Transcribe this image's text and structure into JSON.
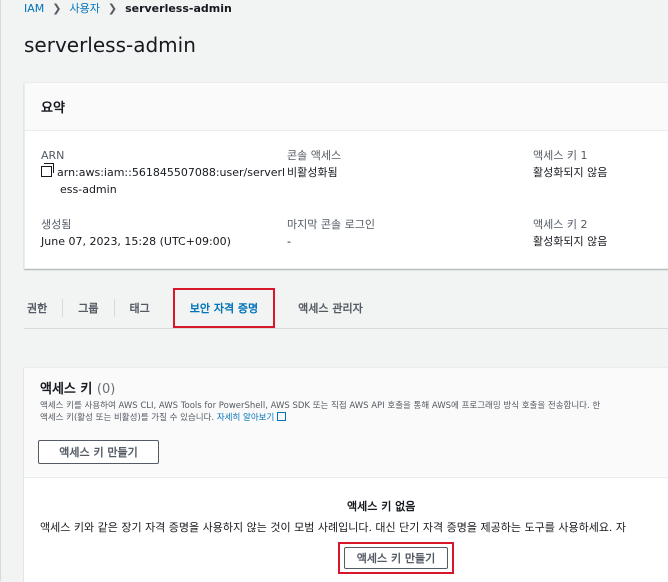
{
  "breadcrumb": {
    "root": "IAM",
    "level1": "사용자",
    "current": "serverless-admin",
    "separator": "❯"
  },
  "page_title": "serverless-admin",
  "summary": {
    "title": "요약",
    "arn_label": "ARN",
    "arn_line1": "arn:aws:iam::561845507088:user/serverl",
    "arn_line2": "ess-admin",
    "created_label": "생성됨",
    "created_value": "June 07, 2023, 15:28 (UTC+09:00)",
    "console_access_label": "콘솔 액세스",
    "console_access_value": "비활성화됨",
    "last_login_label": "마지막 콘솔 로그인",
    "last_login_value": "-",
    "access_key1_label": "액세스 키 1",
    "access_key1_value": "활성화되지 않음",
    "access_key2_label": "액세스 키 2",
    "access_key2_value": "활성화되지 않음"
  },
  "tabs": [
    "권한",
    "그룹",
    "태그",
    "보안 자격 증명",
    "액세스 관리자"
  ],
  "active_tab": "보안 자격 증명",
  "access_keys": {
    "title": "액세스 키",
    "count": "(0)",
    "desc_line1": "액세스 키를 사용하여 AWS CLI, AWS Tools for PowerShell, AWS SDK 또는 직접 AWS API 호출을 통해 AWS에 프로그래밍 방식 호출을 전송합니다. 한",
    "desc_line2": "액세스 키(활성 또는 비활성)를 가질 수 있습니다.",
    "learn_more": "자세히 알아보기",
    "create_button": "액세스 키 만들기",
    "empty_title": "액세스 키 없음",
    "empty_desc": "액세스 키와 같은 장기 자격 증명을 사용하지 않는 것이 모범 사례입니다. 대신 단기 자격 증명을 제공하는 도구를 사용하세요. 자",
    "create_button_center": "액세스 키 만들기"
  },
  "colors": {
    "link": "#0073bb",
    "highlight": "#d8182a",
    "background": "#f2f3f3"
  }
}
